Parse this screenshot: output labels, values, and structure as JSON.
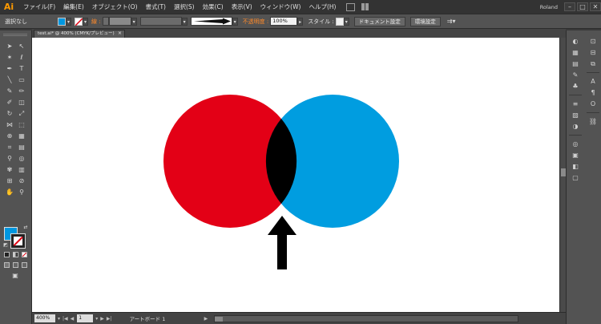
{
  "app": {
    "logo": "Ai"
  },
  "menu": [
    "ファイル(F)",
    "編集(E)",
    "オブジェクト(O)",
    "書式(T)",
    "選択(S)",
    "効果(C)",
    "表示(V)",
    "ウィンドウ(W)",
    "ヘルプ(H)"
  ],
  "window": {
    "user": "Roland",
    "minimize": "–",
    "maximize": "□",
    "close": "✕"
  },
  "controlbar": {
    "selection_label": "選択なし",
    "fill_color": "#0097e0",
    "stroke_label": "線 :",
    "opacity_label": "不透明度 :",
    "opacity_value": "100%",
    "style_label": "スタイル :",
    "doc_settings": "ドキュメント設定",
    "preferences": "環境設定"
  },
  "document_tab": {
    "title": "test.ai* @ 400% (CMYK/プレビュー)",
    "close": "×"
  },
  "canvas": {
    "left_circle_color": "#e30016",
    "right_circle_color": "#009de0",
    "overlap_color": "#000000",
    "arrow_color": "#000000"
  },
  "statusbar": {
    "zoom": "400%",
    "page": "1",
    "artboard_label": "アートボード 1"
  }
}
